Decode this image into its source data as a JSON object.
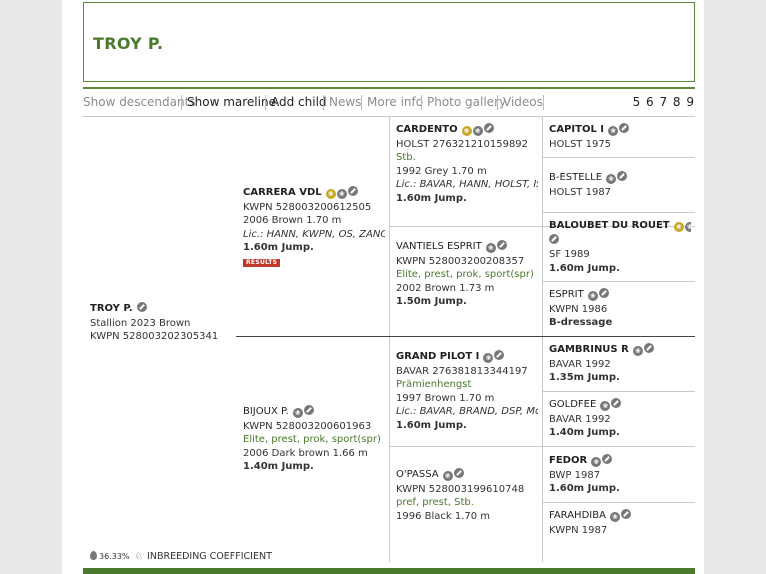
{
  "title": "TROY P.",
  "nav": {
    "items": [
      {
        "label": "Show descendants",
        "style": "muted"
      },
      {
        "label": "Show mareline",
        "style": "dark"
      },
      {
        "label": "Add child",
        "style": "dark"
      },
      {
        "label": "News",
        "style": "muted"
      },
      {
        "label": "More info",
        "style": "muted"
      },
      {
        "label": "Photo gallery",
        "style": "muted"
      },
      {
        "label": "Videos",
        "style": "muted"
      }
    ],
    "pages": "5 6 7 8 9"
  },
  "subject": {
    "name": "TROY P.",
    "line1": "Stallion 2023 Brown",
    "line2": "KWPN 528003202305341"
  },
  "sire": {
    "name": "CARRERA VDL",
    "line1": "KWPN 528003200612505",
    "line2": "2006 Brown 1.70 m",
    "line3": "Lic.: HANN, KWPN, OS, ZANG",
    "line4": "1.60m Jump.",
    "badge": "RESULTS"
  },
  "dam": {
    "name": "BIJOUX P.",
    "line1": "KWPN 528003200601963",
    "line2": "Elite, prest, prok, sport(spr)",
    "line3": "2006 Dark brown 1.66 m",
    "line4": "1.40m Jump."
  },
  "gen3": [
    {
      "name": "CARDENTO",
      "line1": "HOLST 276321210159892",
      "line2": "Stb.",
      "line3": "1992 Grey 1.70 m",
      "line4": "Lic.: BAVAR, HANN, HOLST, ISH, ...",
      "line5": "1.60m Jump."
    },
    {
      "name": "VANTIELS ESPRIT",
      "line1": "KWPN 528003200208357",
      "line2": "Elite, prest, prok, sport(spr)",
      "line3": "2002 Brown 1.73 m",
      "line4": "1.50m Jump."
    },
    {
      "name": "GRAND PILOT I",
      "line1": "BAVAR 276381813344197",
      "line2": "Prämienhengst",
      "line3": "1997 Brown 1.70 m",
      "line4": "Lic.: BAVAR, BRAND, DSP, Mo, O...",
      "line5": "1.60m Jump."
    },
    {
      "name": "O'PASSA",
      "line1": "KWPN 528003199610748",
      "line2": "pref, prest, Stb.",
      "line3": "1996 Black 1.70 m"
    }
  ],
  "gen4": [
    {
      "name": "CAPITOL I",
      "line1": "HOLST 1975"
    },
    {
      "name": "B-ESTELLE",
      "line1": "HOLST 1987"
    },
    {
      "name": "BALOUBET DU ROUET",
      "line1": "SF 1989",
      "line2": "1.60m Jump."
    },
    {
      "name": "ESPRIT",
      "line1": "KWPN 1986",
      "line2": "B-dressage"
    },
    {
      "name": "GAMBRINUS R",
      "line1": "BAVAR 1992",
      "line2": "1.35m Jump."
    },
    {
      "name": "GOLDFEE",
      "line1": "BAVAR 1992",
      "line2": "1.40m Jump."
    },
    {
      "name": "FEDOR",
      "line1": "BWP 1987",
      "line2": "1.60m Jump."
    },
    {
      "name": "FARAHDIBA",
      "line1": "KWPN 1987"
    }
  ],
  "footer": {
    "percent": "36.33%",
    "label": "INBREEDING COEFFICIENT"
  },
  "colors": {
    "accent": "#4a7a2c",
    "gold_icon": "#c6a623",
    "grey_icon": "#777777",
    "results_badge": "#c0392b"
  }
}
